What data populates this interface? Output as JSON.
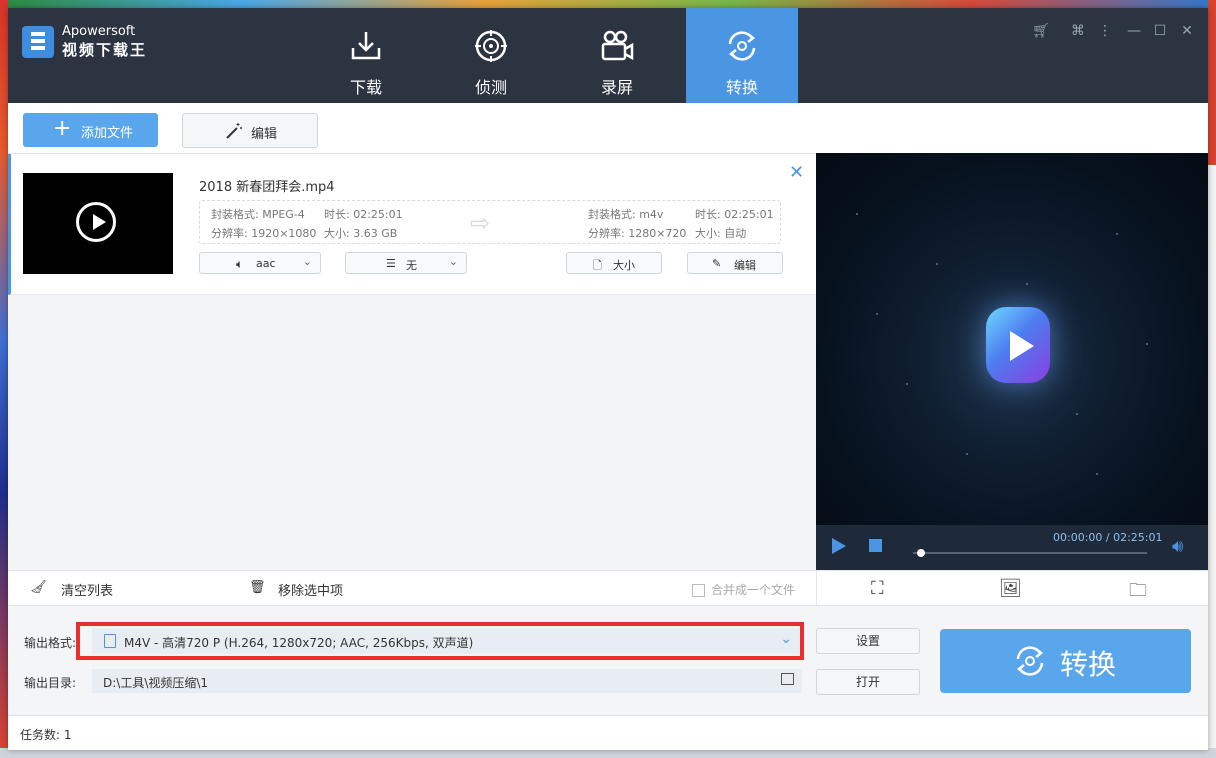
{
  "app": {
    "brand_name": "Apowersoft",
    "product_name": "视频下载王"
  },
  "nav": [
    {
      "label": "下载",
      "icon": "download-icon"
    },
    {
      "label": "侦测",
      "icon": "detect-icon"
    },
    {
      "label": "录屏",
      "icon": "video-camera-icon"
    },
    {
      "label": "转换",
      "icon": "convert-icon",
      "active": true
    }
  ],
  "toolbar": {
    "add_file_label": "添加文件",
    "edit_label": "编辑"
  },
  "file": {
    "name": "2018 新春团拜会.mp4",
    "src_format_label": "封装格式: MPEG-4",
    "src_duration_label": "时长: 02:25:01",
    "src_resolution_label": "分辨率: 1920×1080",
    "src_size_label": "大小: 3.63 GB",
    "dst_format_label": "封装格式: m4v",
    "dst_duration_label": "时长: 02:25:01",
    "dst_resolution_label": "分辨率: 1280×720",
    "dst_size_label": "大小: 自动",
    "audio_select": "aac",
    "subtitle_select": "无",
    "size_button": "大小",
    "edit_button": "编辑"
  },
  "list_bar": {
    "clear_label": "清空列表",
    "remove_label": "移除选中项",
    "merge_label": "合并成一个文件"
  },
  "player": {
    "time": "00:00:00 / 02:25:01",
    "progress": 0
  },
  "output": {
    "format_label": "输出格式:",
    "format_value": "M4V - 高清720 P (H.264, 1280x720; AAC, 256Kbps, 双声道)",
    "dir_label": "输出目录:",
    "dir_value": "D:\\工具\\视频压缩\\1",
    "settings_button": "设置",
    "open_button": "打开",
    "convert_button": "转换"
  },
  "status": {
    "task_count": "任务数: 1"
  },
  "colors": {
    "titlebar": "#2c3442",
    "accent": "#4b96e3",
    "button_blue": "#5aa6ec",
    "highlight_red": "#e5302f"
  }
}
